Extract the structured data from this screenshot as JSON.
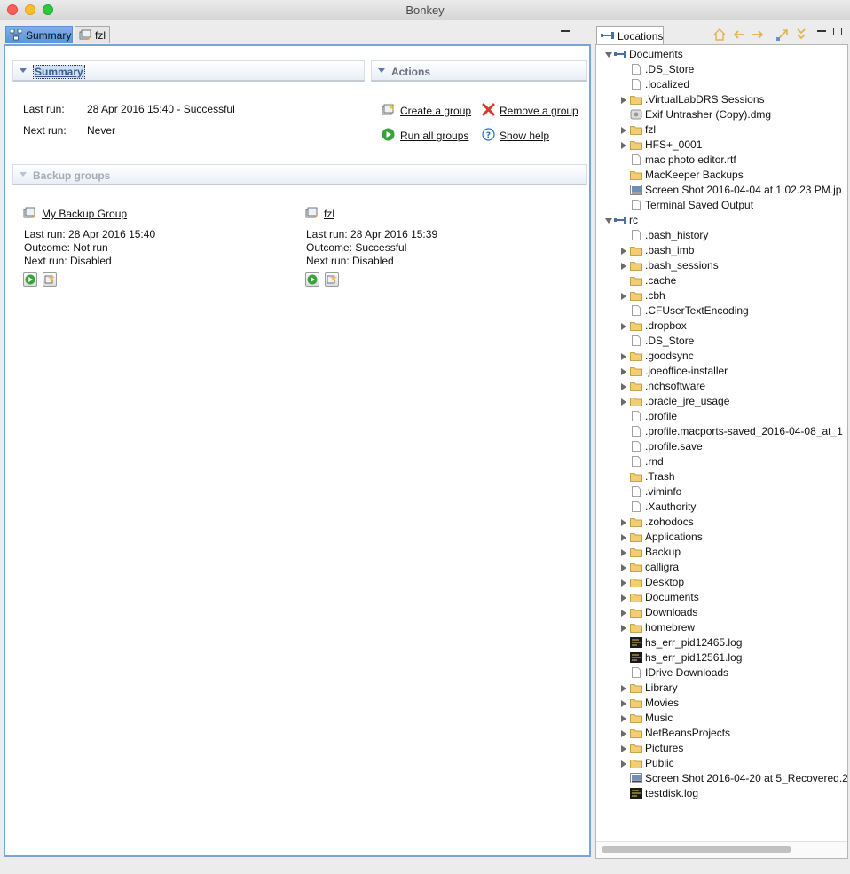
{
  "window": {
    "title": "Bonkey"
  },
  "tabs": [
    {
      "label": "Summary",
      "active": true
    },
    {
      "label": "fzl",
      "active": false
    }
  ],
  "summary": {
    "section_title": "Summary",
    "last_run_label": "Last run:",
    "last_run_value": "28 Apr 2016 15:40 - Successful",
    "next_run_label": "Next run:",
    "next_run_value": "Never"
  },
  "actions": {
    "section_title": "Actions",
    "create_group": "Create a group",
    "remove_group": "Remove a group",
    "run_all_groups": "Run all groups",
    "show_help": "Show help"
  },
  "backup_groups": {
    "section_title": "Backup groups",
    "groups": [
      {
        "name": "My Backup Group",
        "last_run": "Last run: 28 Apr 2016 15:40",
        "outcome": "Outcome: Not run",
        "next_run": "Next run: Disabled"
      },
      {
        "name": "fzl",
        "last_run": "Last run: 28 Apr 2016 15:39",
        "outcome": "Outcome: Successful",
        "next_run": "Next run: Disabled"
      }
    ]
  },
  "locations": {
    "tab_label": "Locations",
    "tree": [
      {
        "label": "Documents",
        "depth": 0,
        "expander": "down",
        "icon": "drive-icon"
      },
      {
        "label": ".DS_Store",
        "depth": 1,
        "expander": "none",
        "icon": "file-icon"
      },
      {
        "label": ".localized",
        "depth": 1,
        "expander": "none",
        "icon": "file-icon"
      },
      {
        "label": ".VirtualLabDRS Sessions",
        "depth": 1,
        "expander": "right",
        "icon": "folder-icon"
      },
      {
        "label": "Exif Untrasher (Copy).dmg",
        "depth": 1,
        "expander": "none",
        "icon": "disk-image-icon"
      },
      {
        "label": "fzl",
        "depth": 1,
        "expander": "right",
        "icon": "folder-icon"
      },
      {
        "label": "HFS+_0001",
        "depth": 1,
        "expander": "right",
        "icon": "folder-icon"
      },
      {
        "label": "mac photo editor.rtf",
        "depth": 1,
        "expander": "none",
        "icon": "file-icon"
      },
      {
        "label": "MacKeeper Backups",
        "depth": 1,
        "expander": "none",
        "icon": "folder-icon"
      },
      {
        "label": "Screen Shot 2016-04-04 at 1.02.23 PM.jp",
        "depth": 1,
        "expander": "none",
        "icon": "image-file-icon"
      },
      {
        "label": "Terminal Saved Output",
        "depth": 1,
        "expander": "none",
        "icon": "file-icon"
      },
      {
        "label": "rc",
        "depth": 0,
        "expander": "down",
        "icon": "drive-icon"
      },
      {
        "label": ".bash_history",
        "depth": 1,
        "expander": "none",
        "icon": "file-icon"
      },
      {
        "label": ".bash_imb",
        "depth": 1,
        "expander": "right",
        "icon": "folder-icon"
      },
      {
        "label": ".bash_sessions",
        "depth": 1,
        "expander": "right",
        "icon": "folder-icon"
      },
      {
        "label": ".cache",
        "depth": 1,
        "expander": "none",
        "icon": "folder-icon"
      },
      {
        "label": ".cbh",
        "depth": 1,
        "expander": "right",
        "icon": "folder-icon"
      },
      {
        "label": ".CFUserTextEncoding",
        "depth": 1,
        "expander": "none",
        "icon": "file-icon"
      },
      {
        "label": ".dropbox",
        "depth": 1,
        "expander": "right",
        "icon": "folder-icon"
      },
      {
        "label": ".DS_Store",
        "depth": 1,
        "expander": "none",
        "icon": "file-icon"
      },
      {
        "label": ".goodsync",
        "depth": 1,
        "expander": "right",
        "icon": "folder-icon"
      },
      {
        "label": ".joeoffice-installer",
        "depth": 1,
        "expander": "right",
        "icon": "folder-icon"
      },
      {
        "label": ".nchsoftware",
        "depth": 1,
        "expander": "right",
        "icon": "folder-icon"
      },
      {
        "label": ".oracle_jre_usage",
        "depth": 1,
        "expander": "right",
        "icon": "folder-icon"
      },
      {
        "label": ".profile",
        "depth": 1,
        "expander": "none",
        "icon": "file-icon"
      },
      {
        "label": ".profile.macports-saved_2016-04-08_at_1",
        "depth": 1,
        "expander": "none",
        "icon": "file-icon"
      },
      {
        "label": ".profile.save",
        "depth": 1,
        "expander": "none",
        "icon": "file-icon"
      },
      {
        "label": ".rnd",
        "depth": 1,
        "expander": "none",
        "icon": "file-icon"
      },
      {
        "label": ".Trash",
        "depth": 1,
        "expander": "none",
        "icon": "folder-icon"
      },
      {
        "label": ".viminfo",
        "depth": 1,
        "expander": "none",
        "icon": "file-icon"
      },
      {
        "label": ".Xauthority",
        "depth": 1,
        "expander": "none",
        "icon": "file-icon"
      },
      {
        "label": ".zohodocs",
        "depth": 1,
        "expander": "right",
        "icon": "folder-icon"
      },
      {
        "label": "Applications",
        "depth": 1,
        "expander": "right",
        "icon": "folder-icon"
      },
      {
        "label": "Backup",
        "depth": 1,
        "expander": "right",
        "icon": "folder-icon"
      },
      {
        "label": "calligra",
        "depth": 1,
        "expander": "right",
        "icon": "folder-icon"
      },
      {
        "label": "Desktop",
        "depth": 1,
        "expander": "right",
        "icon": "folder-icon"
      },
      {
        "label": "Documents",
        "depth": 1,
        "expander": "right",
        "icon": "folder-icon"
      },
      {
        "label": "Downloads",
        "depth": 1,
        "expander": "right",
        "icon": "folder-icon"
      },
      {
        "label": "homebrew",
        "depth": 1,
        "expander": "right",
        "icon": "folder-icon"
      },
      {
        "label": "hs_err_pid12465.log",
        "depth": 1,
        "expander": "none",
        "icon": "log-file-icon"
      },
      {
        "label": "hs_err_pid12561.log",
        "depth": 1,
        "expander": "none",
        "icon": "log-file-icon"
      },
      {
        "label": "IDrive Downloads",
        "depth": 1,
        "expander": "none",
        "icon": "file-icon"
      },
      {
        "label": "Library",
        "depth": 1,
        "expander": "right",
        "icon": "folder-icon"
      },
      {
        "label": "Movies",
        "depth": 1,
        "expander": "right",
        "icon": "folder-icon"
      },
      {
        "label": "Music",
        "depth": 1,
        "expander": "right",
        "icon": "folder-icon"
      },
      {
        "label": "NetBeansProjects",
        "depth": 1,
        "expander": "right",
        "icon": "folder-icon"
      },
      {
        "label": "Pictures",
        "depth": 1,
        "expander": "right",
        "icon": "folder-icon"
      },
      {
        "label": "Public",
        "depth": 1,
        "expander": "right",
        "icon": "folder-icon"
      },
      {
        "label": "Screen Shot 2016-04-20 at 5_Recovered.2",
        "depth": 1,
        "expander": "none",
        "icon": "image-file-icon"
      },
      {
        "label": "testdisk.log",
        "depth": 1,
        "expander": "none",
        "icon": "log-file-icon"
      }
    ]
  },
  "colors": {
    "tab_active": "#6a9fe0",
    "folder": "#f0c566",
    "link_text": "#111111"
  }
}
